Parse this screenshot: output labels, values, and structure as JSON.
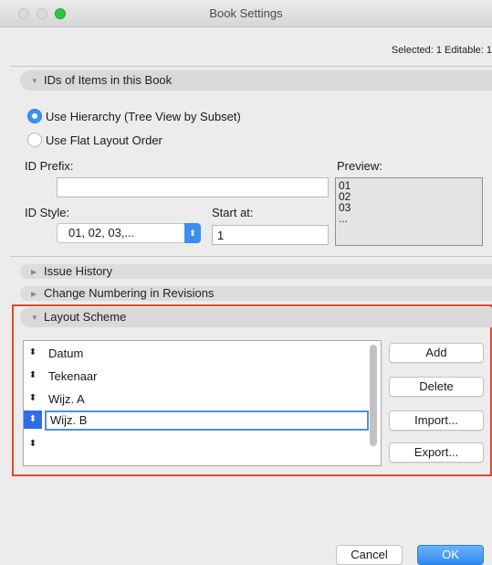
{
  "window": {
    "title": "Book Settings"
  },
  "selection_info": "Selected: 1 Editable: 1",
  "sections": {
    "ids": "IDs of Items in this Book",
    "issue_history": "Issue History",
    "change_numbering": "Change Numbering in Revisions",
    "layout_scheme": "Layout Scheme"
  },
  "radios": {
    "hierarchy": "Use Hierarchy (Tree View by Subset)",
    "flat": "Use Flat Layout Order",
    "selected": "hierarchy"
  },
  "id_prefix": {
    "label": "ID Prefix:",
    "value": ""
  },
  "preview": {
    "label": "Preview:",
    "lines": [
      "01",
      "02",
      "03",
      "..."
    ]
  },
  "id_style": {
    "label": "ID Style:",
    "value": "01, 02, 03,..."
  },
  "start_at": {
    "label": "Start at:",
    "value": "1"
  },
  "layout_scheme": {
    "rows": [
      "Datum",
      "Tekenaar",
      "Wijz. A",
      "Wijz. B",
      ""
    ],
    "selected_row": "Wijz. B"
  },
  "side_buttons": {
    "add": "Add",
    "delete": "Delete",
    "import": "Import...",
    "export": "Export..."
  },
  "footer": {
    "cancel": "Cancel",
    "ok": "OK"
  },
  "colors": {
    "accent": "#3b8ef0",
    "highlight_border": "#e0492d"
  },
  "icons": {
    "handle": "reorder-handle-icon",
    "disclosure": "disclosure-triangle-icon",
    "popup": "popup-arrows-icon"
  }
}
